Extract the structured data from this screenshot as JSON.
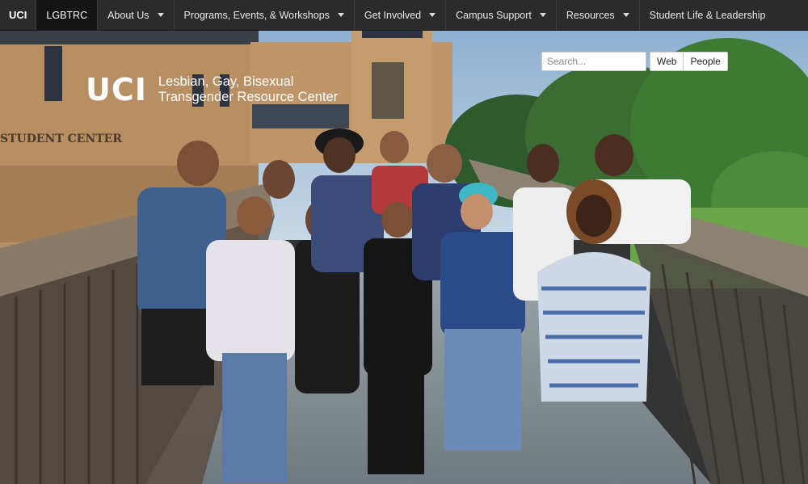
{
  "nav": {
    "home": "UCI",
    "site": "LGBTRC",
    "items": [
      {
        "label": "About Us",
        "dropdown": true
      },
      {
        "label": "Programs, Events, & Workshops",
        "dropdown": true
      },
      {
        "label": "Get Involved",
        "dropdown": true
      },
      {
        "label": "Campus Support",
        "dropdown": true
      },
      {
        "label": "Resources",
        "dropdown": true
      },
      {
        "label": "Student Life & Leadership",
        "dropdown": false
      }
    ]
  },
  "brand": {
    "logo": "UCI",
    "line1": "Lesbian, Gay, Bisexual",
    "line2": "Transgender Resource Center"
  },
  "search": {
    "placeholder": "Search...",
    "web_label": "Web",
    "people_label": "People"
  },
  "hero": {
    "building_sign": "STUDENT CENTER"
  },
  "colors": {
    "nav_bg": "#2b2b2b",
    "nav_active": "#141414",
    "sky": "#a9c4de"
  }
}
